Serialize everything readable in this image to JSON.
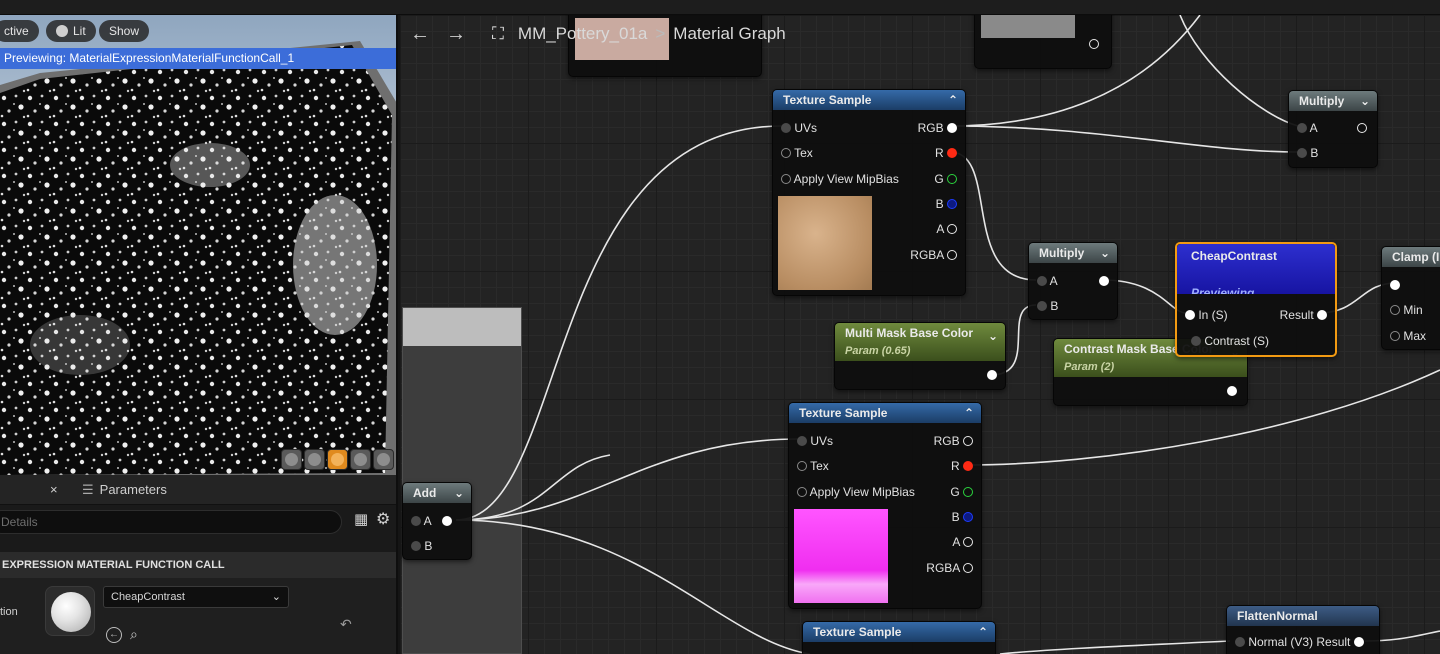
{
  "viewport": {
    "buttons": [
      "ctive",
      "Lit",
      "Show"
    ],
    "preview_label": "Previewing: MaterialExpressionMaterialFunctionCall_1"
  },
  "details": {
    "close": "×",
    "params_tab": "Parameters",
    "search_placeholder": "Details",
    "section": "EXPRESSION MATERIAL FUNCTION CALL",
    "row_label": "tion",
    "function_value": "CheapContrast"
  },
  "nav": {
    "asset": "MM_Pottery_01a",
    "separator": ">",
    "graph": "Material Graph"
  },
  "nodes": {
    "tex1": {
      "title": "Texture Sample",
      "inputs": [
        "UVs",
        "Tex",
        "Apply View MipBias"
      ],
      "outputs": [
        "RGB",
        "R",
        "G",
        "B",
        "A",
        "RGBA"
      ]
    },
    "tex2": {
      "title": "Texture Sample",
      "inputs": [
        "UVs",
        "Tex",
        "Apply View MipBias"
      ],
      "outputs": [
        "RGB",
        "R",
        "G",
        "B",
        "A",
        "RGBA"
      ]
    },
    "tex3": {
      "title": "Texture Sample"
    },
    "mult_top": {
      "title": "Multiply",
      "inputs": [
        "A",
        "B"
      ]
    },
    "mult_mid": {
      "title": "Multiply",
      "inputs": [
        "A",
        "B"
      ]
    },
    "add": {
      "title": "Add",
      "inputs": [
        "A",
        "B"
      ]
    },
    "cheap": {
      "title": "CheapContrast",
      "status": "Previewing",
      "inputs": [
        "In (S)",
        "Contrast (S)"
      ],
      "output": "Result"
    },
    "mask_base": {
      "title": "Multi Mask Base Color",
      "sub": "Param (0.65)"
    },
    "contrast_mask": {
      "title": "Contrast Mask Base Color",
      "sub": "Param (2)"
    },
    "clamp": {
      "title": "Clamp (I",
      "inputs": [
        "Min",
        "Max"
      ]
    },
    "flatten": {
      "title": "FlattenNormal",
      "pin": "Normal (V3) Result"
    }
  },
  "colors": {
    "accent_orange": "#f29a12",
    "pin_red": "#ff2a14",
    "pin_green": "#2bd33e",
    "pin_blue": "#1d3cff",
    "banner_blue": "#3c6dd9"
  }
}
